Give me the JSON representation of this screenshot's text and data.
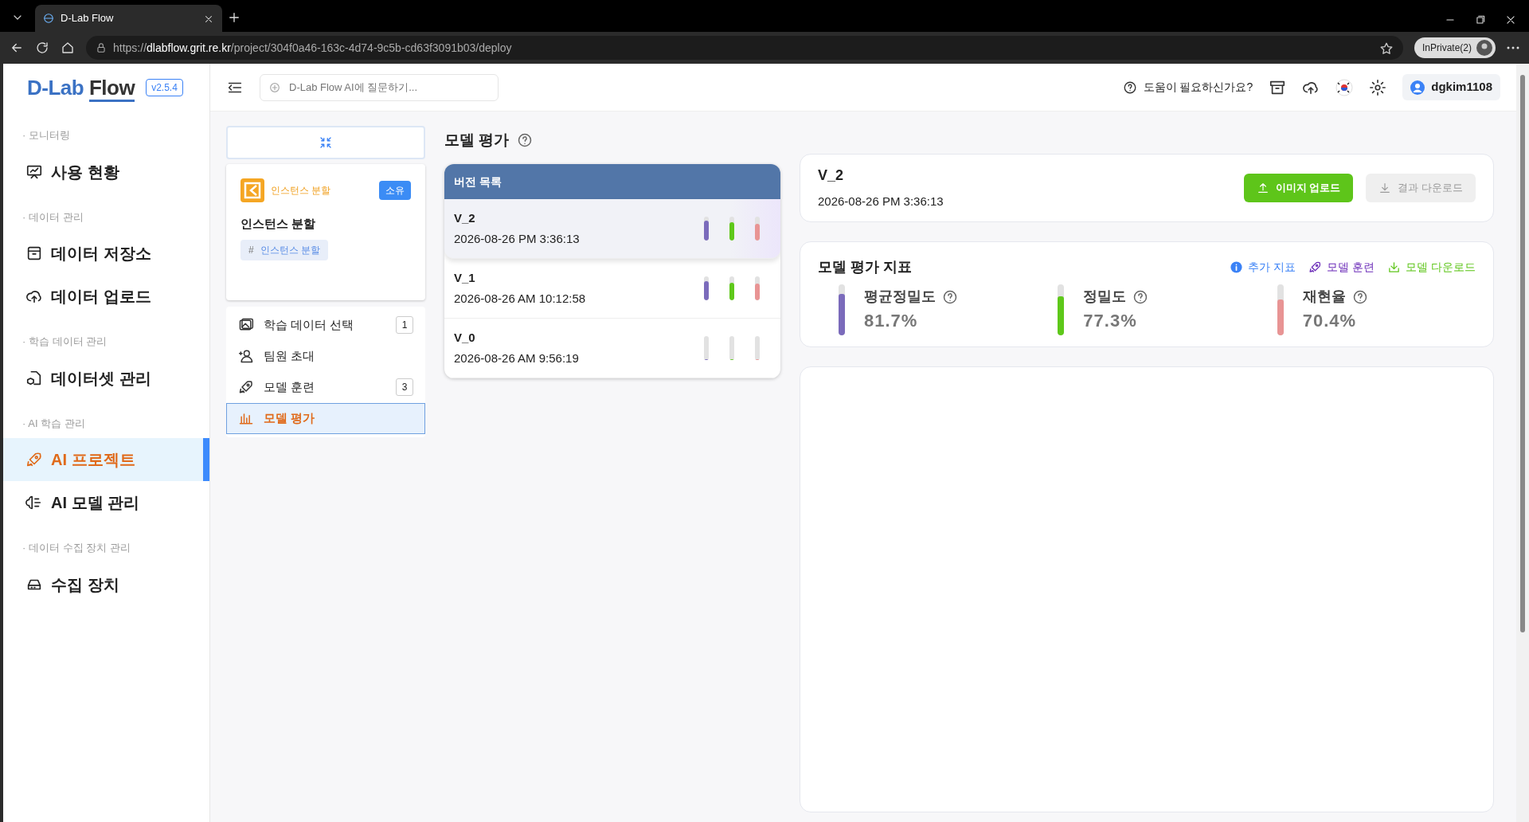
{
  "browser": {
    "url_scheme": "https://",
    "tab_title": "D-Lab Flow",
    "url_host": "dlabflow.grit.re.kr",
    "url_path": "/project/304f0a46-163c-4d74-9c5b-cd63f3091b03/deploy",
    "profile": "InPrivate(2)"
  },
  "header": {
    "logo_part1": "D-Lab",
    "logo_part2": "Flow",
    "version": "v2.5.4",
    "search_placeholder": "D-Lab Flow AI에 질문하기...",
    "help": "도움이 필요하신가요?",
    "user": "dgkim1108"
  },
  "sidebar": [
    {
      "section": "· 모니터링",
      "items": [
        {
          "label": "사용 현황",
          "selected": false
        }
      ]
    },
    {
      "section": "· 데이터 관리",
      "items": [
        {
          "label": "데이터 저장소",
          "selected": false
        },
        {
          "label": "데이터 업로드",
          "selected": false
        }
      ]
    },
    {
      "section": "· 학습 데이터 관리",
      "items": [
        {
          "label": "데이터셋 관리",
          "selected": false
        }
      ]
    },
    {
      "section": "· AI 학습 관리",
      "items": [
        {
          "label": "AI 프로젝트",
          "selected": true
        },
        {
          "label": "AI 모델 관리",
          "selected": false
        }
      ]
    },
    {
      "section": "· 데이터 수집 장치 관리",
      "items": [
        {
          "label": "수집 장치",
          "selected": false
        }
      ]
    }
  ],
  "project": {
    "type_label": "인스턴스 분할",
    "badge": "소유",
    "name": "인스턴스 분할",
    "tag_symbol": "#",
    "tag": "인스턴스 분할"
  },
  "steps": [
    {
      "label": "학습 데이터 선택",
      "count": "1",
      "selected": false
    },
    {
      "label": "팀원 초대",
      "selected": false
    },
    {
      "label": "모델 훈련",
      "count": "3",
      "selected": false
    },
    {
      "label": "모델 평가",
      "selected": true
    }
  ],
  "page_title": "모델 평가",
  "versions": {
    "title": "버전 목록",
    "items": [
      {
        "name": "V_2",
        "date": "2026-08-26 PM 3:36:13",
        "selected": true,
        "bars": [
          {
            "level": 0.82
          },
          {
            "level": 0.77
          },
          {
            "level": 0.7
          }
        ]
      },
      {
        "name": "V_1",
        "date": "2026-08-26 AM 10:12:58",
        "selected": false,
        "bars": [
          {
            "level": 0.8
          },
          {
            "level": 0.75
          },
          {
            "level": 0.7
          }
        ]
      },
      {
        "name": "V_0",
        "date": "2026-08-26 AM 9:56:19",
        "selected": false,
        "bars": [
          {
            "level": 0.03
          },
          {
            "level": 0.02
          },
          {
            "level": 0.05
          }
        ]
      }
    ]
  },
  "detail": {
    "name": "V_2",
    "date": "2026-08-26 PM 3:36:13",
    "upload_button": "이미지 업로드",
    "download_button": "결과 다운로드",
    "download_disabled": true
  },
  "metrics": {
    "title": "모델 평가 지표",
    "links": [
      {
        "label": "추가 지표",
        "kind": "info"
      },
      {
        "label": "모델 훈련",
        "kind": "rocket"
      },
      {
        "label": "모델 다운로드",
        "kind": "download"
      }
    ],
    "items": [
      {
        "label": "평균정밀도",
        "value": "81.7%",
        "level": 0.817,
        "color": "#7b6bbb"
      },
      {
        "label": "정밀도",
        "value": "77.3%",
        "level": 0.773,
        "color": "#5ec81a"
      },
      {
        "label": "재현율",
        "value": "70.4%",
        "level": 0.704,
        "color": "#e89494"
      }
    ]
  }
}
